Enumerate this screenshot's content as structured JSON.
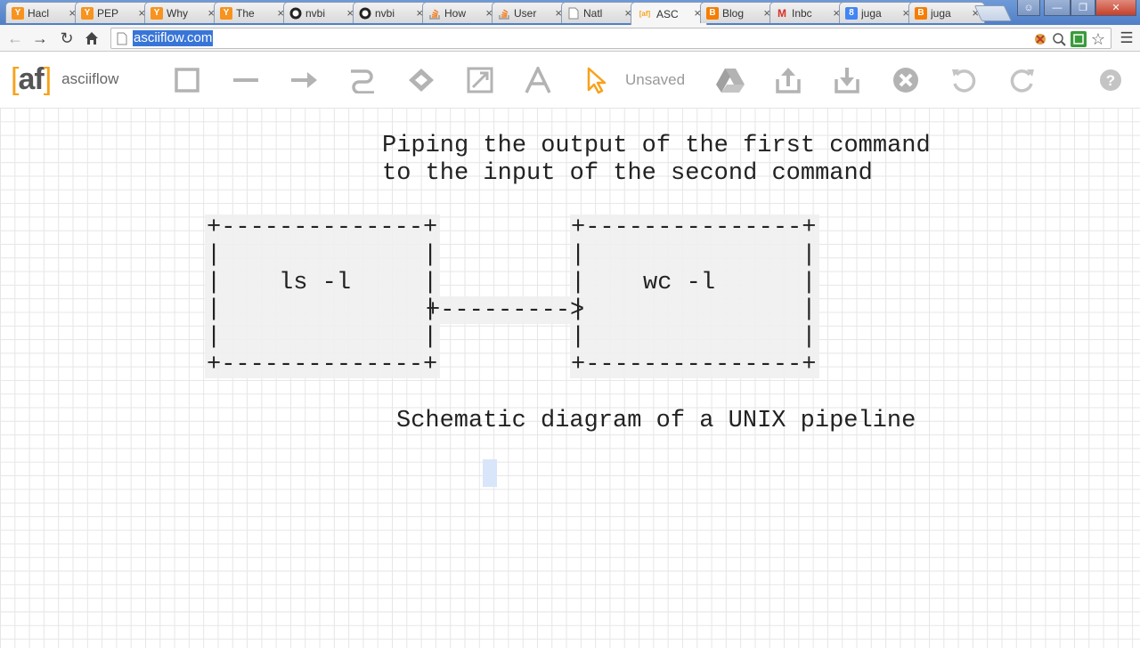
{
  "browser": {
    "tabs": [
      {
        "title": "Hacl",
        "favicon": "Y",
        "color": "#f7931e"
      },
      {
        "title": "PEP",
        "favicon": "Y",
        "color": "#f7931e"
      },
      {
        "title": "Why",
        "favicon": "Y",
        "color": "#f7931e"
      },
      {
        "title": "The",
        "favicon": "Y",
        "color": "#f7931e"
      },
      {
        "title": "nvbi",
        "favicon": "github",
        "color": "#222222"
      },
      {
        "title": "nvbi",
        "favicon": "github",
        "color": "#222222"
      },
      {
        "title": "How",
        "favicon": "stack",
        "color": "#f48024"
      },
      {
        "title": "User",
        "favicon": "stack",
        "color": "#f48024"
      },
      {
        "title": "Natl",
        "favicon": "doc",
        "color": "#aaaaaa"
      },
      {
        "title": "ASC",
        "favicon": "[af]",
        "color": "#f7a21b",
        "active": true
      },
      {
        "title": "Blog",
        "favicon": "B",
        "color": "#f57d00"
      },
      {
        "title": "Inbc",
        "favicon": "M",
        "color": "#d93025"
      },
      {
        "title": "juga",
        "favicon": "8",
        "color": "#4285f4"
      },
      {
        "title": "juga",
        "favicon": "B",
        "color": "#f57d00"
      }
    ],
    "url": "asciiflow.com"
  },
  "app": {
    "logo": "[af]",
    "name": "asciiflow",
    "status": "Unsaved"
  },
  "diagram": {
    "title_line1": "Piping the output of the first command",
    "title_line2": "to the input of the second command",
    "box1": [
      "+--------------+",
      "|              |",
      "|    ls -l     |",
      "|              |",
      "|              |",
      "+--------------+"
    ],
    "box2": [
      "+---------------+",
      "|               |",
      "|    wc -l      |",
      "|               |",
      "|               |",
      "+---------------+"
    ],
    "arrow": "+--------->",
    "caption": "Schematic diagram of a UNIX pipeline"
  },
  "icons": {
    "tools": [
      "rectangle-icon",
      "line-icon",
      "arrow-icon",
      "freeform-icon",
      "erase-icon",
      "resize-icon",
      "text-icon",
      "select-icon"
    ],
    "actions": [
      "drive-icon",
      "export-icon",
      "import-icon",
      "clear-icon",
      "undo-icon",
      "redo-icon",
      "help-icon"
    ],
    "accent": "#f7a21b",
    "tool_gray": "#b3b3b3"
  }
}
